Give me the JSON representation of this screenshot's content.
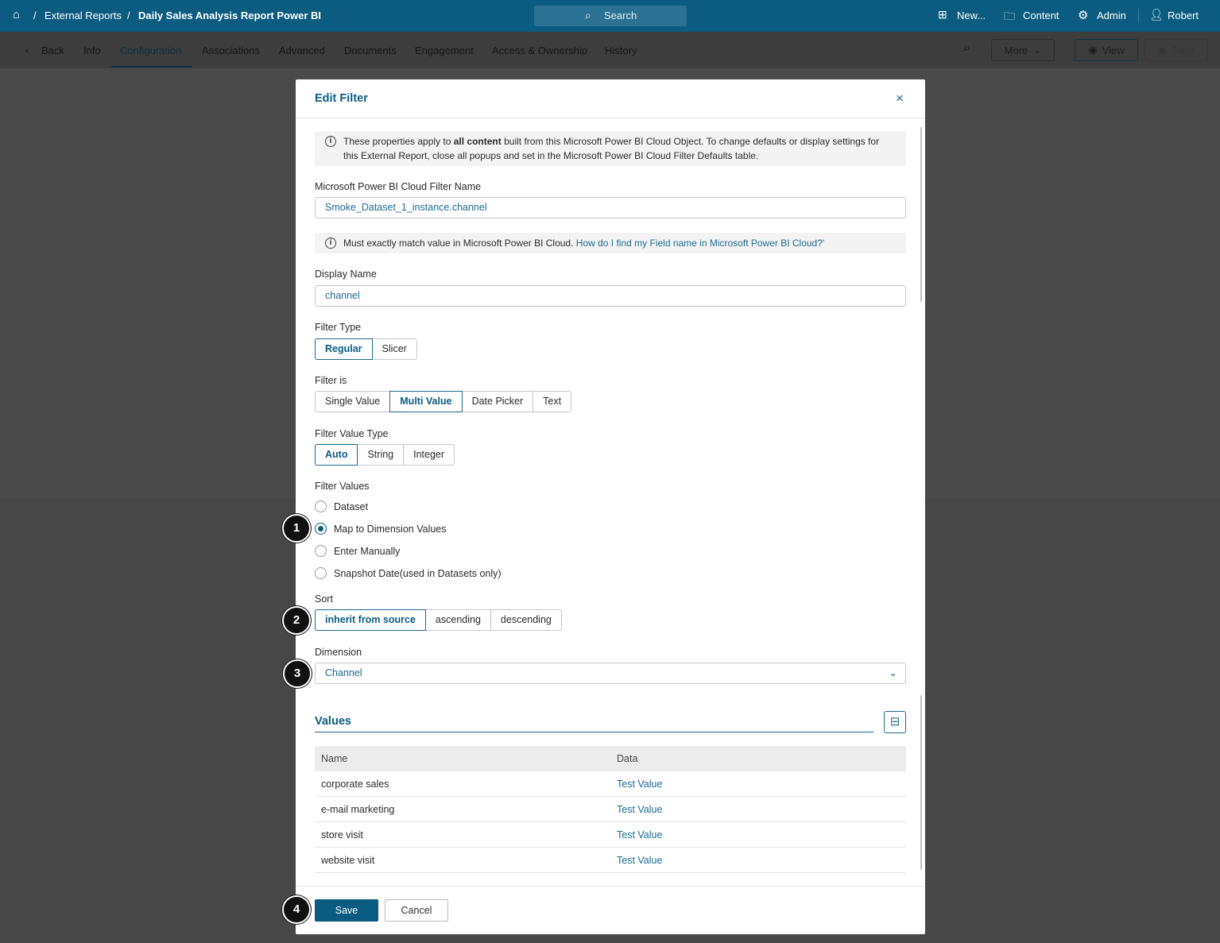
{
  "topbar": {
    "breadcrumb_sep": "/",
    "crumb1": "External Reports",
    "crumb2": "Daily Sales Analysis Report Power BI",
    "search": "Search",
    "new": "New...",
    "content": "Content",
    "admin": "Admin",
    "user": "Robert"
  },
  "subnav": {
    "back": "Back",
    "tabs": [
      "Info",
      "Configuration",
      "Associations",
      "Advanced",
      "Documents",
      "Engagement",
      "Access & Ownership",
      "History"
    ],
    "more": "More",
    "view": "View",
    "save": "Save"
  },
  "modal": {
    "title": "Edit Filter",
    "info1_pre": "These properties apply to ",
    "info1_bold": "all content",
    "info1_post": " built from this Microsoft Power BI Cloud Object. To change defaults or display settings for this External Report, close all popups and set in the Microsoft Power BI Cloud Filter Defaults table.",
    "filter_name_label": "Microsoft Power BI Cloud Filter Name",
    "filter_name_value": "Smoke_Dataset_1_instance.channel",
    "info2_text": "Must exactly match value in Microsoft Power BI Cloud. ",
    "info2_link": "How do I find my Field name in Microsoft Power BI Cloud?'",
    "display_name_label": "Display Name",
    "display_name_value": "channel",
    "filter_type_label": "Filter Type",
    "filter_type_options": [
      "Regular",
      "Slicer"
    ],
    "filter_is_label": "Filter is",
    "filter_is_options": [
      "Single Value",
      "Multi Value",
      "Date Picker",
      "Text"
    ],
    "value_type_label": "Filter Value Type",
    "value_type_options": [
      "Auto",
      "String",
      "Integer"
    ],
    "filter_values_label": "Filter Values",
    "filter_values_options": [
      "Dataset",
      "Map to Dimension Values",
      "Enter Manually",
      "Snapshot Date(used in Datasets only)"
    ],
    "sort_label": "Sort",
    "sort_options": [
      "inherit from source",
      "ascending",
      "descending"
    ],
    "dimension_label": "Dimension",
    "dimension_value": "Channel",
    "values_title": "Values",
    "table": {
      "headers": [
        "Name",
        "Data"
      ],
      "rows": [
        [
          "corporate sales",
          "Test Value"
        ],
        [
          "e-mail marketing",
          "Test Value"
        ],
        [
          "store visit",
          "Test Value"
        ],
        [
          "website visit",
          "Test Value"
        ]
      ]
    },
    "save": "Save",
    "cancel": "Cancel"
  },
  "callouts": [
    "1",
    "2",
    "3",
    "4"
  ],
  "colors": {
    "brand": "#0b5c80",
    "link": "#1f6b8f"
  }
}
